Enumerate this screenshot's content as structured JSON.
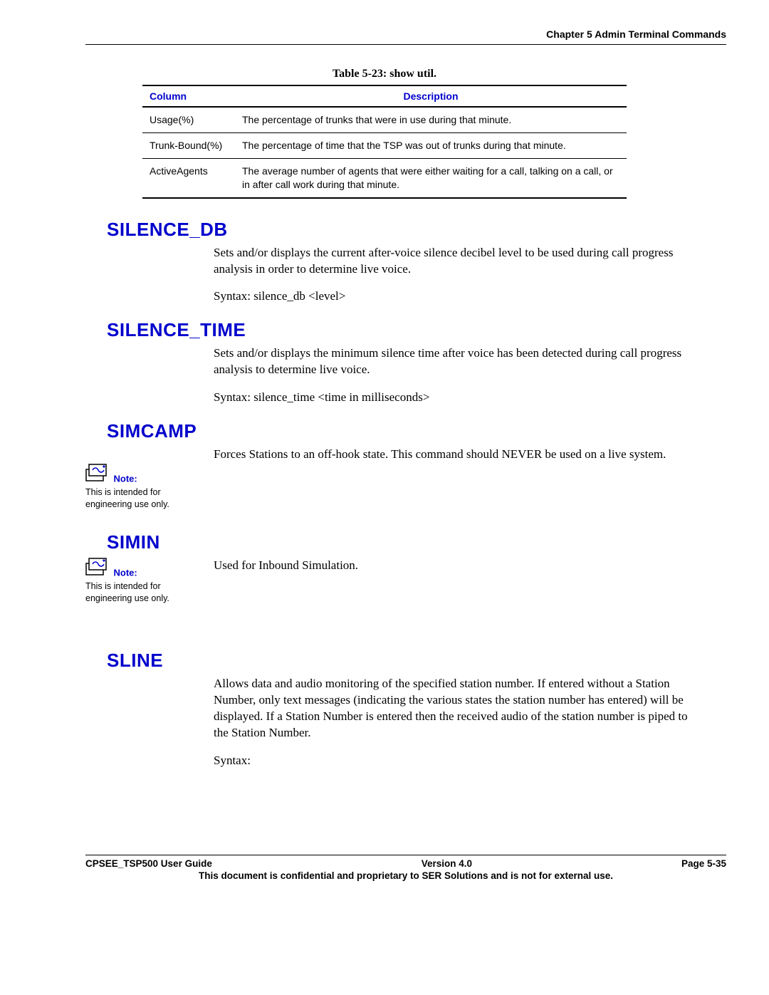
{
  "header": {
    "chapter": "Chapter 5 Admin Terminal Commands"
  },
  "table": {
    "caption": "Table 5-23: show util.",
    "headers": {
      "col": "Column",
      "desc": "Description"
    },
    "rows": [
      {
        "col": "Usage(%)",
        "desc": "The percentage of trunks that were in use during that minute."
      },
      {
        "col": "Trunk-Bound(%)",
        "desc": "The percentage of time that the TSP was out of trunks during that minute."
      },
      {
        "col": "ActiveAgents",
        "desc": "The average number of agents that were either waiting for a call, talking on a call, or in after call work during that minute."
      }
    ]
  },
  "sections": {
    "silence_db": {
      "title": "SILENCE_DB",
      "p1": "Sets and/or displays the current after-voice silence decibel level to be used during call progress analysis in order to determine live voice.",
      "p2": "Syntax:  silence_db <level>"
    },
    "silence_time": {
      "title": "SILENCE_TIME",
      "p1": "Sets and/or displays the minimum silence time after voice has been detected during call progress analysis to determine live voice.",
      "p2": "Syntax:  silence_time <time in milliseconds>"
    },
    "simcamp": {
      "title": "SIMCAMP",
      "p1": "Forces Stations to an off-hook state.  This command should NEVER be used on a live system.",
      "note_label": "Note:",
      "note_text": "This is intended for engineering use only."
    },
    "simin": {
      "title": "SIMIN",
      "p1": "Used for Inbound Simulation.",
      "note_label": "Note:",
      "note_text": "This is intended for engineering use only."
    },
    "sline": {
      "title": "SLINE",
      "p1": "Allows data and audio monitoring of the specified station number.  If entered without a Station Number, only text messages (indicating the various states the station number has entered) will be displayed.  If a Station Number is entered then the received audio of the station number is piped to the Station Number.",
      "p2": "Syntax:"
    }
  },
  "footer": {
    "left": "CPSEE_TSP500 User Guide",
    "center": "Version 4.0",
    "right": "Page 5-35",
    "bottom": "This document is confidential and proprietary to SER Solutions and is not for external use."
  }
}
